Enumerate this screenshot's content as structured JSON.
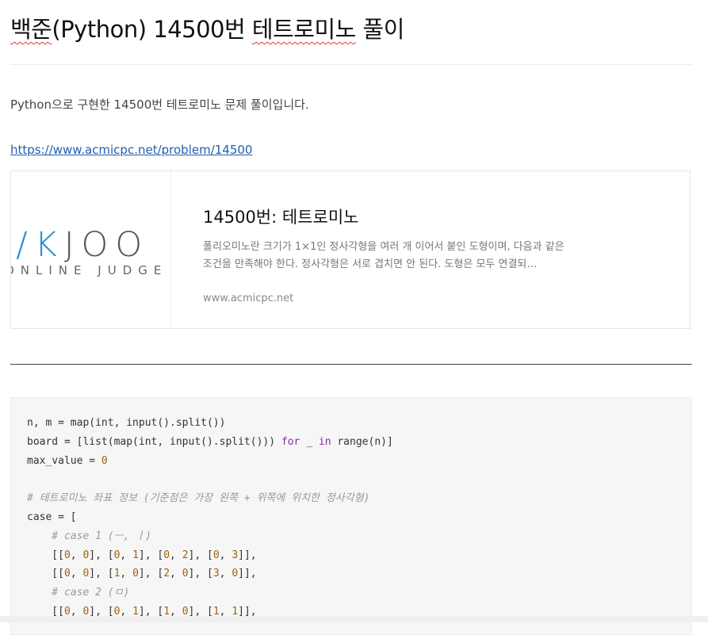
{
  "post": {
    "title_prefix": "백준",
    "title_middle": "(Python) 14500번 ",
    "title_suffix": "테트로미노",
    "title_end": " 풀이",
    "intro": "Python으로 구현한 14500번 테트로미노 문제 풀이입니다.",
    "link": "https://www.acmicpc.net/problem/14500"
  },
  "card": {
    "logo_text_left": "E",
    "logo_text_accent": "/K",
    "logo_text_right": "JOO",
    "logo_sub": "ONLINE JUDGE",
    "title": "14500번: 테트로미노",
    "description": "폴리오미노란 크기가 1×1인 정사각형을 여러 개 이어서 붙인 도형이며, 다음과 같은 조건을 만족해야 한다. 정사각형은 서로 겹치면 안 된다. 도형은 모두 연결되…",
    "domain": "www.acmicpc.net"
  },
  "code": {
    "line1": "n, m = map(int, input().split())",
    "line2a": "board = [list(map(int, input().split())) ",
    "line2_for": "for",
    "line2b": " _ ",
    "line2_in": "in",
    "line2c": " range(n)]",
    "line3a": "max_value = ",
    "line3_num": "0",
    "line5": "# 테트로미노 좌표 정보 (기준점은 가장 왼쪽 + 위쪽에 위치한 정사각형)",
    "line6": "case = [",
    "line7": "    # case 1 (ㅡ, ㅣ)",
    "line10": "    # case 2 (ㅁ)"
  },
  "colors": {
    "link": "#1f5fb0",
    "keyword": "#8a2ba8",
    "number": "#a0620a",
    "comment": "#999999",
    "logo_accent": "#1e8ed6"
  }
}
